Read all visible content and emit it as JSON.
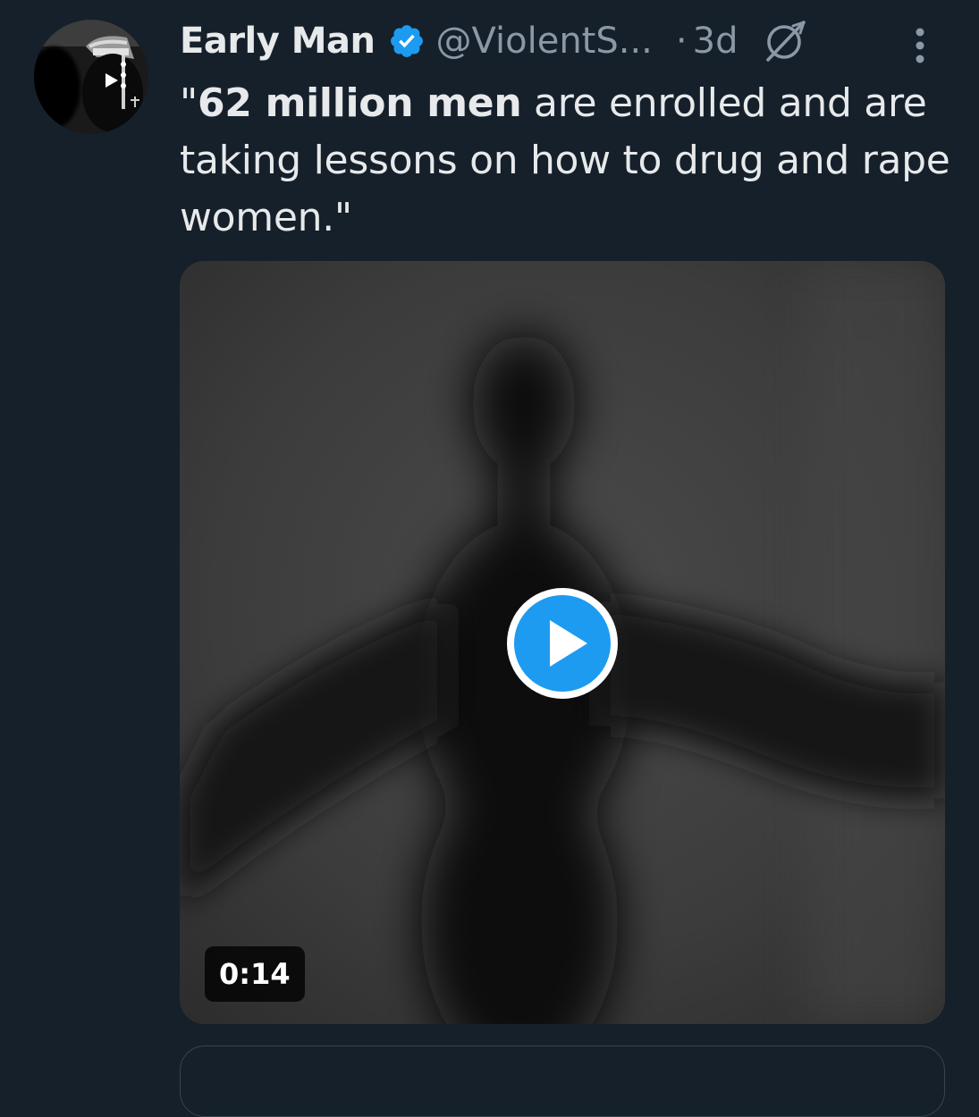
{
  "tweet": {
    "author": {
      "display_name": "Early Man",
      "handle": "@ViolentS...",
      "verified": true,
      "avatar_icon": "avatar-image"
    },
    "separator": "·",
    "timestamp": "3d",
    "icons": {
      "verified": "verified-badge-icon",
      "grok": "grok-icon",
      "more": "more-vertical-icon",
      "play": "play-icon"
    },
    "text": {
      "open_quote": "\"",
      "bold_part": "62 million men",
      "rest": " are enrolled and are taking lessons on how to drug and rape women.\""
    },
    "media": {
      "type": "video",
      "duration": "0:14"
    }
  },
  "colors": {
    "background": "#15202b",
    "primary_text": "#e7e9ea",
    "secondary_text": "#8b98a5",
    "accent": "#1d9bf0",
    "border": "#38444d"
  }
}
